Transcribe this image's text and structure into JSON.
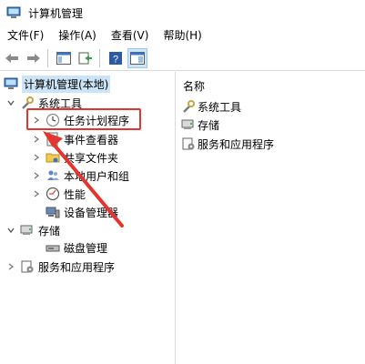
{
  "window": {
    "title": "计算机管理"
  },
  "menu": [
    "文件(F)",
    "操作(A)",
    "查看(V)",
    "帮助(H)"
  ],
  "tree": {
    "root": "计算机管理(本地)",
    "system_tools": "系统工具",
    "task_scheduler": "任务计划程序",
    "event_viewer": "事件查看器",
    "shared_folders": "共享文件夹",
    "local_users": "本地用户和组",
    "performance": "性能",
    "device_manager": "设备管理器",
    "storage": "存储",
    "disk_management": "磁盘管理",
    "services": "服务和应用程序"
  },
  "list": {
    "header": "名称",
    "items": [
      "系统工具",
      "存储",
      "服务和应用程序"
    ]
  },
  "colors": {
    "highlight": "#e3342f",
    "arrow": "#e3342f",
    "selection": "#cce4f7"
  }
}
